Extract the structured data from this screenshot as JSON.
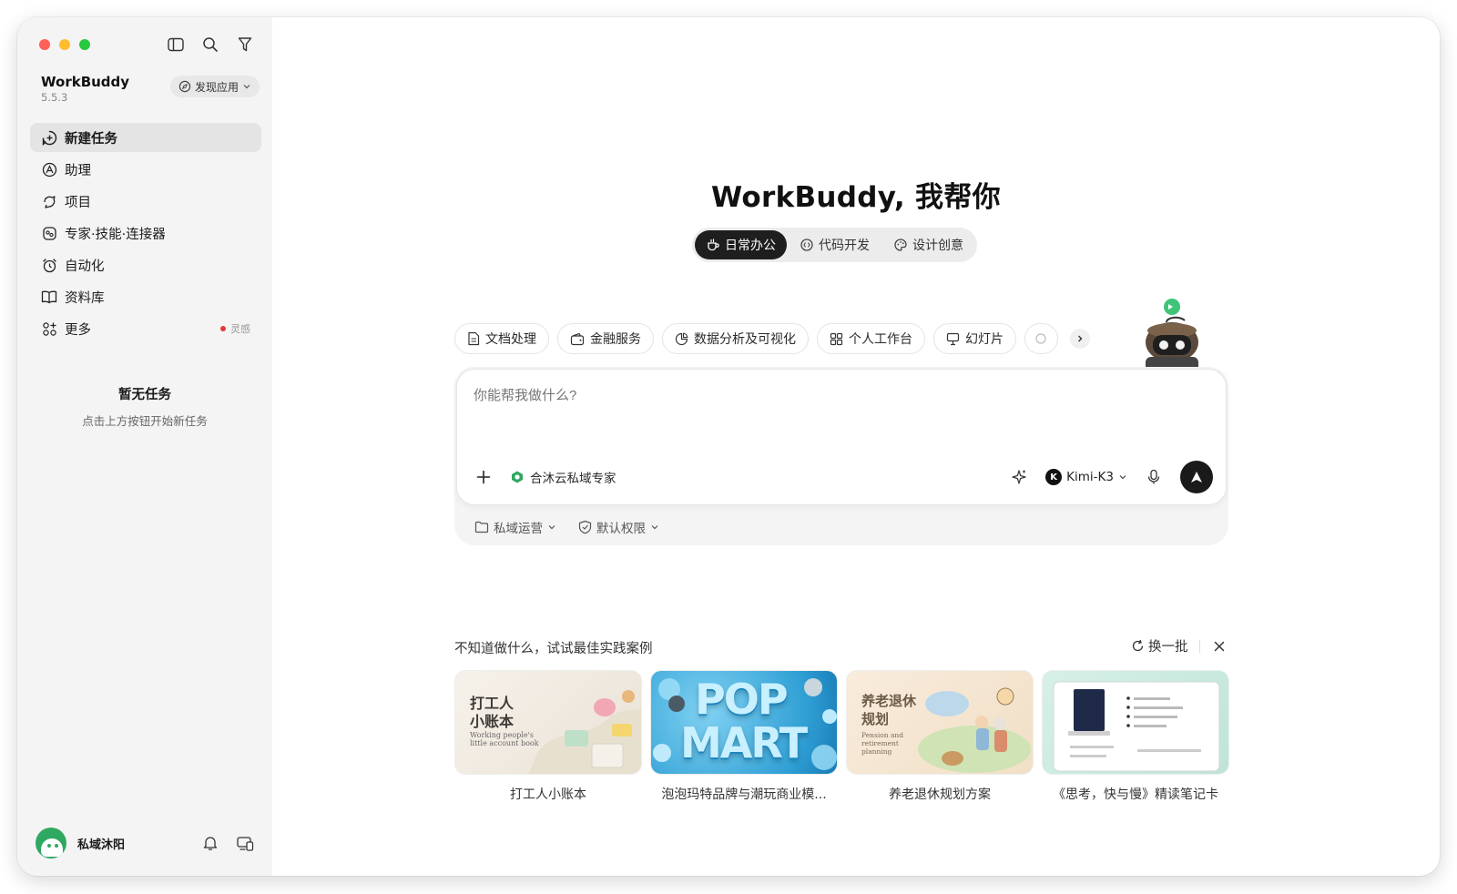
{
  "app": {
    "name": "WorkBuddy",
    "version": "5.5.3",
    "discover_label": "发现应用"
  },
  "sidebar": {
    "items": [
      {
        "label": "新建任务",
        "icon": "plus-circle-icon",
        "active": true
      },
      {
        "label": "助理",
        "icon": "assistant-icon"
      },
      {
        "label": "项目",
        "icon": "project-icon"
      },
      {
        "label": "专家·技能·连接器",
        "icon": "expert-icon"
      },
      {
        "label": "自动化",
        "icon": "alarm-icon"
      },
      {
        "label": "资料库",
        "icon": "book-icon"
      },
      {
        "label": "更多",
        "icon": "more-icon",
        "badge": "灵感"
      }
    ],
    "empty_title": "暂无任务",
    "empty_subtitle": "点击上方按钮开始新任务",
    "user_name": "私域沐阳"
  },
  "main": {
    "hero_title": "WorkBuddy, 我帮你",
    "modes": [
      "日常办公",
      "代码开发",
      "设计创意"
    ],
    "active_mode": "日常办公",
    "chips": [
      "文档处理",
      "金融服务",
      "数据分析及可视化",
      "个人工作台",
      "幻灯片"
    ],
    "composer": {
      "placeholder": "你能帮我做什么?",
      "expert_label": "合沐云私域专家",
      "model": "Kimi-K3",
      "workspace": "私域运营",
      "permission": "默认权限"
    },
    "cases": {
      "title": "不知道做什么，试试最佳实践案例",
      "refresh_label": "换一批",
      "items": [
        {
          "label": "打工人小账本",
          "thumb_title_1": "打工人",
          "thumb_title_2": "小账本",
          "thumb_sub_1": "Working people's",
          "thumb_sub_2": "little account book"
        },
        {
          "label": "泡泡玛特品牌与潮玩商业模...",
          "thumb_text_1": "POP",
          "thumb_text_2": "MART"
        },
        {
          "label": "养老退休规划方案",
          "thumb_title_1": "养老退休",
          "thumb_title_2": "规划",
          "thumb_sub_1": "Pension and",
          "thumb_sub_2": "retirement",
          "thumb_sub_3": "planning"
        },
        {
          "label": "《思考，快与慢》精读笔记卡"
        }
      ]
    }
  }
}
